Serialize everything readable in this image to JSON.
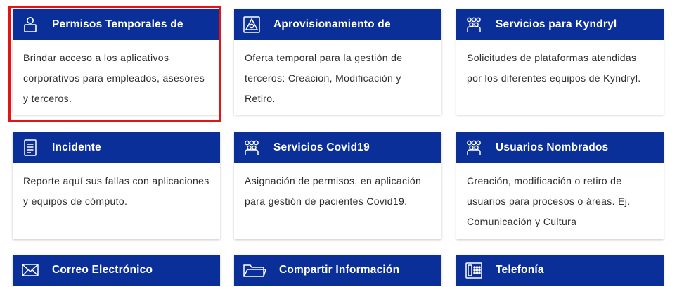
{
  "cards": [
    {
      "title": "Permisos Temporales de",
      "icon": "person-icon",
      "description": "Brindar acceso a los aplicativos corporativos para empleados, asesores y terceros.",
      "selected": true
    },
    {
      "title": "Aprovisionamiento de",
      "icon": "provisioning-icon",
      "description": "Oferta temporal para la gestión de terceros: Creacion, Modificación y Retiro."
    },
    {
      "title": "Servicios para Kyndryl",
      "icon": "group-icon",
      "description": "Solicitudes de plataformas atendidas por los diferentes equipos de Kyndryl."
    },
    {
      "title": "Incidente",
      "icon": "document-icon",
      "description": "Reporte aquí sus fallas con aplicaciones y equipos de cómputo."
    },
    {
      "title": "Servicios Covid19",
      "icon": "group-icon",
      "description": "Asignación de permisos, en aplicación para gestión de pacientes Covid19."
    },
    {
      "title": "Usuarios Nombrados",
      "icon": "group-icon",
      "description": "Creación, modificación o retiro de usuarios para procesos o áreas. Ej. Comunicación y Cultura"
    },
    {
      "title": "Correo Electrónico",
      "icon": "envelope-icon",
      "description": ""
    },
    {
      "title": "Compartir Información",
      "icon": "folder-icon",
      "description": ""
    },
    {
      "title": "Telefonía",
      "icon": "phone-icon",
      "description": ""
    }
  ],
  "colors": {
    "header_bg": "#0a2f99",
    "selection_outline": "#e41414"
  }
}
